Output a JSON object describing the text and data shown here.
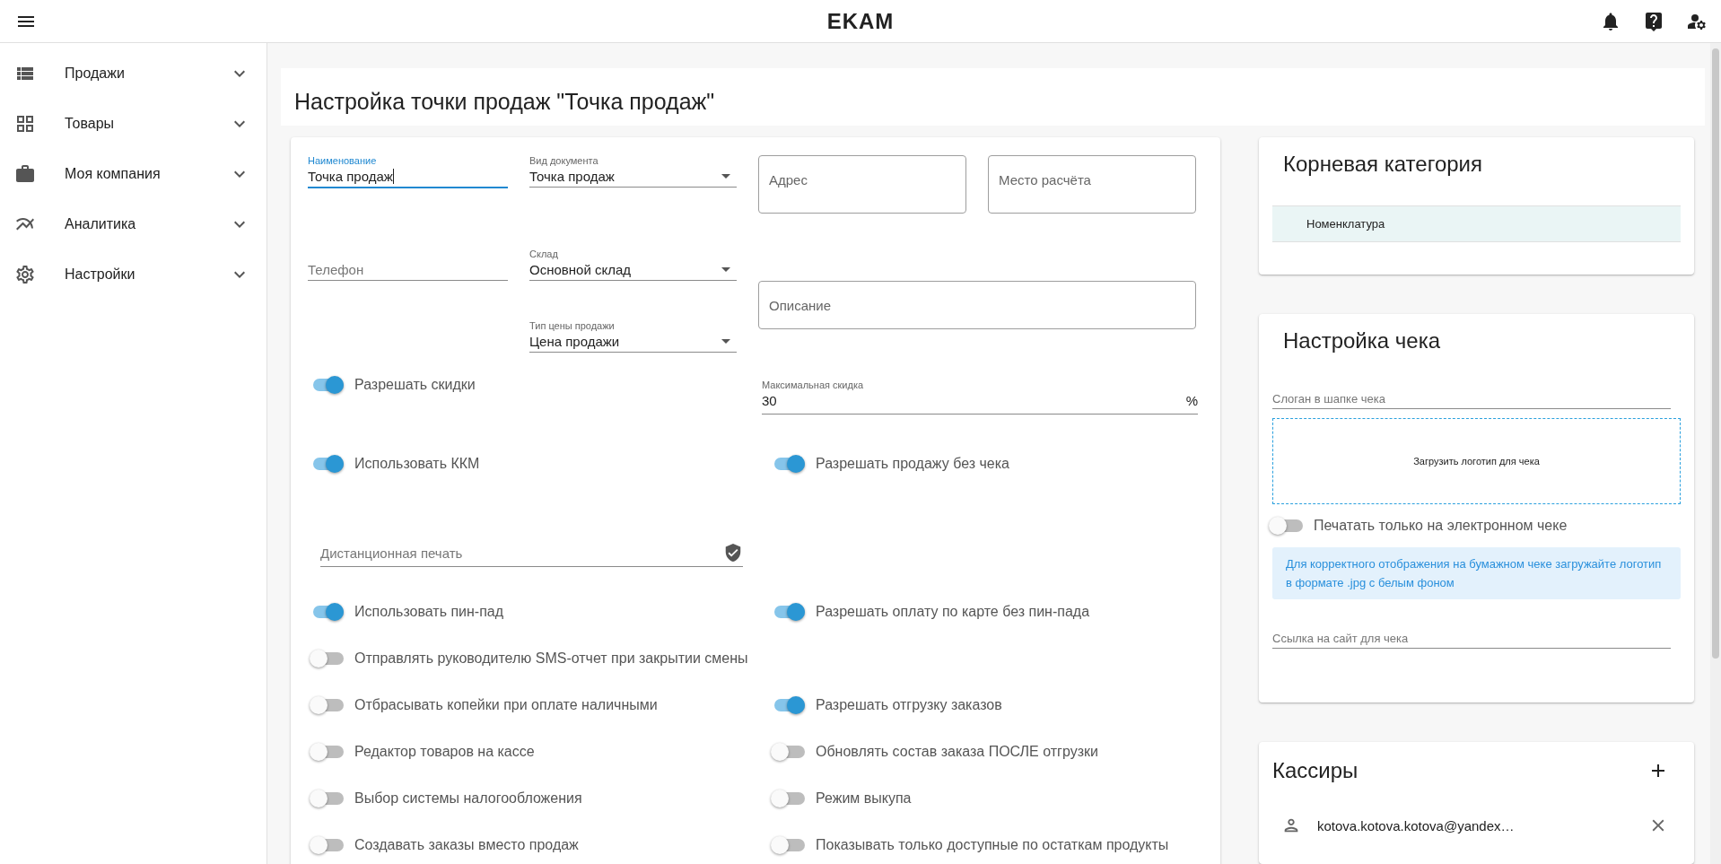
{
  "app_bar": {
    "logo": "EKAM"
  },
  "sidebar": {
    "items": [
      {
        "label": "Продажи",
        "expanded": false
      },
      {
        "label": "Товары",
        "expanded": false
      },
      {
        "label": "Моя компания",
        "expanded": false
      },
      {
        "label": "Аналитика",
        "expanded": false
      },
      {
        "label": "Настройки",
        "expanded": false
      }
    ]
  },
  "page_title": "Настройка точки продаж \"Точка продаж\"",
  "form": {
    "fields": [
      {
        "kind": "text",
        "label": "Наименование",
        "value": "Точка продаж",
        "focused": true
      },
      {
        "kind": "select",
        "label": "Вид документа",
        "value": "Точка продаж"
      },
      {
        "kind": "outlined",
        "placeholder": "Адрес"
      },
      {
        "kind": "outlined",
        "placeholder": "Место расчёта"
      },
      {
        "kind": "text",
        "placeholder": "Телефон",
        "focused": false
      },
      {
        "kind": "select",
        "label": "Склад",
        "value": "Основной склад"
      },
      {
        "kind": "outlined",
        "placeholder": "Описание"
      },
      {
        "kind": "select",
        "label": "Тип цены продажи",
        "value": "Цена продажи"
      }
    ],
    "rows": [
      {
        "left": {
          "kind": "toggle",
          "label": "Разрешать скидки",
          "on": true
        },
        "right": {
          "kind": "number",
          "label": "Максимальная скидка",
          "value": "30",
          "suffix": "%"
        }
      },
      {
        "left": {
          "kind": "toggle",
          "label": "Использовать ККМ",
          "on": true
        },
        "right": {
          "kind": "toggle",
          "label": "Разрешать продажу без чека",
          "on": true
        }
      },
      {
        "left": {
          "kind": "secure",
          "placeholder": "Дистанционная печать"
        }
      },
      {
        "left": {
          "kind": "toggle",
          "label": "Использовать пин-пад",
          "on": true
        },
        "right": {
          "kind": "toggle",
          "label": "Разрешать оплату по карте без пин-пада",
          "on": true
        }
      },
      {
        "left": {
          "kind": "toggle",
          "label": "Отправлять руководителю SMS-отчет при закрытии смены",
          "on": false
        }
      },
      {
        "left": {
          "kind": "toggle",
          "label": "Отбрасывать копейки при оплате наличными",
          "on": false
        },
        "right": {
          "kind": "toggle",
          "label": "Разрешать отгрузку заказов",
          "on": true
        }
      },
      {
        "left": {
          "kind": "toggle",
          "label": "Редактор товаров на кассе",
          "on": false
        },
        "right": {
          "kind": "toggle",
          "label": "Обновлять состав заказа ПОСЛЕ отгрузки",
          "on": false
        }
      },
      {
        "left": {
          "kind": "toggle",
          "label": "Выбор системы налогообложения",
          "on": false
        },
        "right": {
          "kind": "toggle",
          "label": "Режим выкупа",
          "on": false
        }
      },
      {
        "left": {
          "kind": "toggle",
          "label": "Создавать заказы вместо продаж",
          "on": false
        },
        "right": {
          "kind": "toggle",
          "label": "Показывать только доступные по остаткам продукты",
          "on": false
        }
      }
    ]
  },
  "root_category": {
    "title": "Корневая категория",
    "items": [
      {
        "label": "Номенклатура",
        "selected": true
      }
    ]
  },
  "receipt": {
    "title": "Настройка чека",
    "slogan_placeholder": "Слоган в шапке чека",
    "upload_label": "Загрузить логотип для чека",
    "toggle": {
      "label": "Печатать только на электронном чеке",
      "on": false
    },
    "info": "Для корректного отображения на бумажном чеке загружайте логотип в формате .jpg с белым фоном",
    "site_placeholder": "Ссылка на сайт для чека"
  },
  "cashiers": {
    "title": "Кассиры",
    "items": [
      {
        "email": "kotova.kotova.kotova@yandex…"
      }
    ]
  }
}
